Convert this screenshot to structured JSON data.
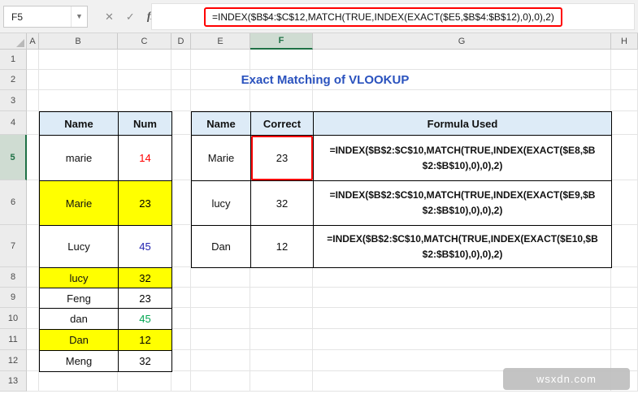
{
  "formula_bar": {
    "name_box": "F5",
    "cancel_icon": "✕",
    "enter_icon": "✓",
    "fx_label": "fx",
    "formula": "=INDEX($B$4:$C$12,MATCH(TRUE,INDEX(EXACT($E5,$B$4:$B$12),0),0),2)"
  },
  "grid": {
    "columns": [
      "A",
      "B",
      "C",
      "D",
      "E",
      "F",
      "G",
      "H"
    ],
    "rows": [
      "1",
      "2",
      "3",
      "4",
      "5",
      "6",
      "7",
      "8",
      "9",
      "10",
      "11",
      "12",
      "13"
    ],
    "selected_column": "F",
    "selected_row": "5",
    "selected_cell": "F5"
  },
  "title": "Exact Matching of VLOOKUP",
  "left_table": {
    "headers": [
      "Name",
      "Num"
    ],
    "rows": [
      {
        "name": "marie",
        "num": "14",
        "num_color": "#ff0000"
      },
      {
        "name": "Marie",
        "num": "23",
        "num_color": "#000000",
        "bg": "#ffff00"
      },
      {
        "name": "Lucy",
        "num": "45",
        "num_color": "#2323b0"
      },
      {
        "name": "lucy",
        "num": "32",
        "num_color": "#000000",
        "bg": "#ffff00"
      },
      {
        "name": "Feng",
        "num": "23",
        "num_color": "#000000"
      },
      {
        "name": "dan",
        "num": "45",
        "num_color": "#00a550"
      },
      {
        "name": "Dan",
        "num": "12",
        "num_color": "#000000",
        "bg": "#ffff00"
      },
      {
        "name": "Meng",
        "num": "32",
        "num_color": "#000000"
      }
    ]
  },
  "right_table": {
    "headers": [
      "Name",
      "Correct",
      "Formula Used"
    ],
    "rows": [
      {
        "name": "Marie",
        "correct": "23",
        "annotated": true,
        "formula": "=INDEX($B$2:$C$10,MATCH(TRUE,INDEX(EXACT($E8,$B$2:$B$10),0),0),2)"
      },
      {
        "name": "lucy",
        "correct": "32",
        "formula": "=INDEX($B$2:$C$10,MATCH(TRUE,INDEX(EXACT($E9,$B$2:$B$10),0),0),2)"
      },
      {
        "name": "Dan",
        "correct": "12",
        "formula": "=INDEX($B$2:$C$10,MATCH(TRUE,INDEX(EXACT($E10,$B$2:$B$10),0),0),2)"
      }
    ]
  },
  "watermark": "wsxdn.com",
  "colors": {
    "annotation": "#ff0000",
    "header_fill": "#ddebf7",
    "highlight": "#ffff00",
    "title": "#2a52be"
  }
}
